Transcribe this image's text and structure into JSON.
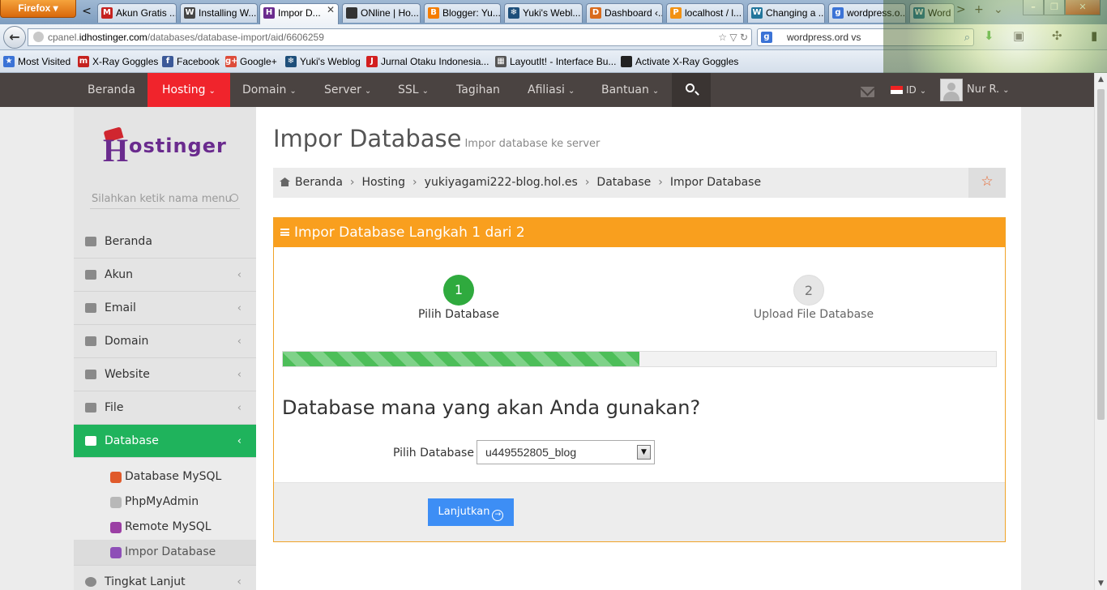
{
  "browser": {
    "menu_label": "Firefox",
    "tab_scroll_left": "<",
    "tab_scroll_right": ">",
    "new_tab": "+",
    "tab_list": "⌄",
    "tabs": [
      {
        "title": "Akun Gratis ...",
        "icon": "gmail-icon",
        "color": "#c5221f",
        "glyph": "M"
      },
      {
        "title": "Installing W...",
        "icon": "wordpress-icon",
        "color": "#464646",
        "glyph": "W"
      },
      {
        "title": "Impor D...",
        "icon": "hostinger-icon",
        "color": "#6a2b8e",
        "glyph": "H",
        "active": true
      },
      {
        "title": "ONline | Ho...",
        "icon": "site-icon",
        "color": "#333333",
        "glyph": ""
      },
      {
        "title": "Blogger: Yu...",
        "icon": "blogger-icon",
        "color": "#f57d00",
        "glyph": "B"
      },
      {
        "title": "Yuki's Webl...",
        "icon": "snowflake-icon",
        "color": "#1e4f7a",
        "glyph": "❄"
      },
      {
        "title": "Dashboard ‹...",
        "icon": "dashboard-icon",
        "color": "#d96b1c",
        "glyph": "D"
      },
      {
        "title": "localhost / l...",
        "icon": "phpmyadmin-icon",
        "color": "#f29111",
        "glyph": "P"
      },
      {
        "title": "Changing a ...",
        "icon": "wordpress-icon",
        "color": "#21759b",
        "glyph": "W"
      },
      {
        "title": "wordpress.o...",
        "icon": "google-icon",
        "color": "#3b73d6",
        "glyph": "g"
      },
      {
        "title": "Word",
        "icon": "wordpress-icon",
        "color": "#21759b",
        "glyph": "W"
      }
    ],
    "url": {
      "prefix": "cpanel.",
      "host": "idhostinger.com",
      "path": "/databases/database-import/aid/6606259"
    },
    "search_query": "wordpress.ord vs",
    "bookmarks": [
      {
        "label": "Most Visited",
        "color": "#3b73d6",
        "glyph": "★"
      },
      {
        "label": "X-Ray Goggles",
        "color": "#c5221f",
        "glyph": "m"
      },
      {
        "label": "Facebook",
        "color": "#3b5998",
        "glyph": "f"
      },
      {
        "label": "Google+",
        "color": "#dd4b39",
        "glyph": "g+"
      },
      {
        "label": "Yuki's Weblog",
        "color": "#1e4f7a",
        "glyph": "❄"
      },
      {
        "label": "Jurnal Otaku Indonesia...",
        "color": "#d21f1f",
        "glyph": "J"
      },
      {
        "label": "LayoutIt! - Interface Bu...",
        "color": "#555555",
        "glyph": "▦"
      },
      {
        "label": "Activate X-Ray Goggles",
        "color": "#222222",
        "glyph": ""
      }
    ]
  },
  "topnav": {
    "items": [
      {
        "label": "Beranda",
        "caret": false
      },
      {
        "label": "Hosting",
        "caret": true,
        "active": true
      },
      {
        "label": "Domain",
        "caret": true
      },
      {
        "label": "Server",
        "caret": true
      },
      {
        "label": "SSL",
        "caret": true
      },
      {
        "label": "Tagihan",
        "caret": false
      },
      {
        "label": "Afiliasi",
        "caret": true
      },
      {
        "label": "Bantuan",
        "caret": true
      }
    ],
    "language": "ID",
    "user_name": "Nur R."
  },
  "sidebar": {
    "logo_text": "ostinger",
    "logo_letter": "H",
    "search_placeholder": "Silahkan ketik nama menu",
    "items": [
      {
        "label": "Beranda",
        "icon": "dashboard-icon"
      },
      {
        "label": "Akun",
        "icon": "info-icon",
        "chevron": "‹"
      },
      {
        "label": "Email",
        "icon": "envelope-icon",
        "chevron": "‹"
      },
      {
        "label": "Domain",
        "icon": "globe-icon",
        "chevron": "‹"
      },
      {
        "label": "Website",
        "icon": "monitor-icon",
        "chevron": "‹"
      },
      {
        "label": "File",
        "icon": "folder-icon",
        "chevron": "‹"
      },
      {
        "label": "Database",
        "icon": "archive-icon",
        "chevron": "‹",
        "active": true
      }
    ],
    "sub_items": [
      {
        "label": "Database MySQL",
        "icon": "mysql-icon",
        "color": "#e05a2b"
      },
      {
        "label": "PhpMyAdmin",
        "icon": "phpmyadmin-icon",
        "color": "#b8b8b8"
      },
      {
        "label": "Remote MySQL",
        "icon": "remote-db-icon",
        "color": "#9b3fa4"
      },
      {
        "label": "Impor Database",
        "icon": "import-db-icon",
        "color": "#8e4fb7",
        "active": true
      }
    ],
    "next_item": {
      "label": "Tingkat Lanjut",
      "icon": "gears-icon",
      "chevron": "‹"
    }
  },
  "page": {
    "title": "Impor Database",
    "subtitle": "Impor database ke server",
    "breadcrumb": [
      "Beranda",
      "Hosting",
      "yukiyagami222-blog.hol.es",
      "Database",
      "Impor Database"
    ],
    "favorite_glyph": "☆"
  },
  "wizard": {
    "header": "Impor Database Langkah 1 dari 2",
    "steps": [
      {
        "number": "1",
        "label": "Pilih Database",
        "done": true
      },
      {
        "number": "2",
        "label": "Upload File Database",
        "done": false
      }
    ],
    "progress_percent": 50,
    "question": "Database mana yang akan Anda gunakan?",
    "select_label": "Pilih Database",
    "select_value": "u449552805_blog",
    "next_label": "Lanjutkan",
    "colors": {
      "header": "#f99f1e",
      "progress": "#4dbe59",
      "button": "#3d8ef5",
      "active_nav": "#f0242c",
      "active_side": "#1fb35c"
    }
  }
}
